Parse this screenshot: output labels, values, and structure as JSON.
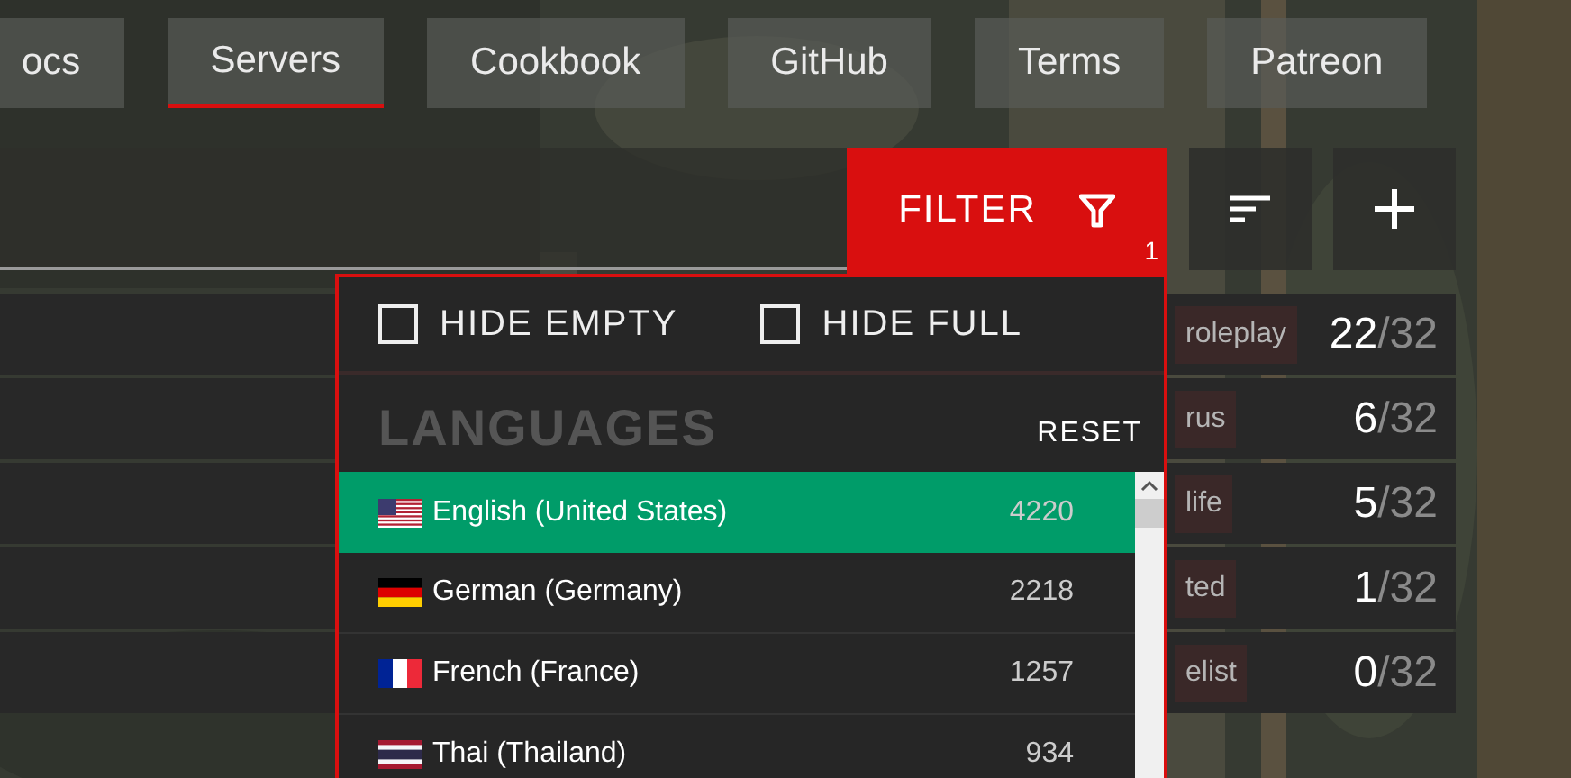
{
  "nav": {
    "tabs": [
      {
        "label": "ocs",
        "selected": false
      },
      {
        "label": "Servers",
        "selected": true
      },
      {
        "label": "Cookbook",
        "selected": false
      },
      {
        "label": "GitHub",
        "selected": false
      },
      {
        "label": "Terms",
        "selected": false
      },
      {
        "label": "Patreon",
        "selected": false
      }
    ]
  },
  "toolbar": {
    "filter": {
      "label": "FILTER",
      "badge": "1",
      "active": true
    }
  },
  "servers": [
    {
      "tag": "roleplay",
      "players": "22",
      "max": "/32"
    },
    {
      "tag": "rus",
      "players": "6",
      "max": "/32"
    },
    {
      "tag": "life",
      "players": "5",
      "max": "/32"
    },
    {
      "tag": "ted",
      "players": "1",
      "max": "/32"
    },
    {
      "tag": "elist",
      "players": "0",
      "max": "/32"
    }
  ],
  "filter_panel": {
    "options": [
      {
        "label": "HIDE EMPTY",
        "checked": false
      },
      {
        "label": "HIDE FULL",
        "checked": false
      }
    ],
    "languages_title": "LANGUAGES",
    "reset": "RESET",
    "languages": [
      {
        "kind": "us",
        "name": "English (United States)",
        "count": "4220",
        "selected": true
      },
      {
        "kind": "de",
        "name": "German (Germany)",
        "count": "2218",
        "selected": false
      },
      {
        "kind": "fr",
        "name": "French (France)",
        "count": "1257",
        "selected": false
      },
      {
        "kind": "th",
        "name": "Thai (Thailand)",
        "count": "934",
        "selected": false
      }
    ]
  }
}
